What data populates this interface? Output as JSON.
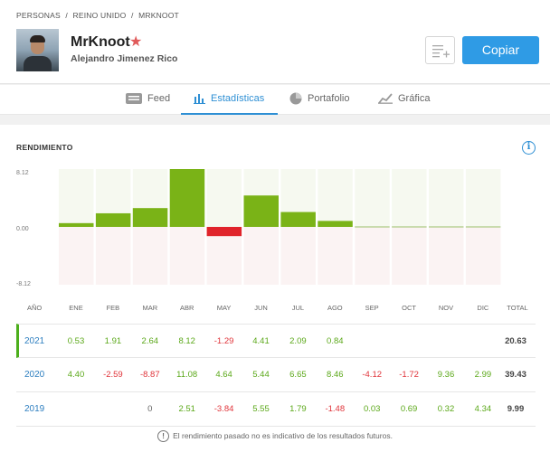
{
  "breadcrumb": [
    "PERSONAS",
    "/",
    "REINO UNIDO",
    "/",
    "MRKNOOT"
  ],
  "profile": {
    "username": "MrKnoot",
    "fullname": "Alejandro Jimenez Rico",
    "star": "★"
  },
  "buttons": {
    "copy": "Copiar"
  },
  "tabs": [
    {
      "label": "Feed",
      "icon": "feed-icon"
    },
    {
      "label": "Estadísticas",
      "icon": "stats-icon",
      "active": true
    },
    {
      "label": "Portafolio",
      "icon": "pie-icon"
    },
    {
      "label": "Gráfica",
      "icon": "chart-icon"
    }
  ],
  "stats": {
    "title": "RENDIMIENTO",
    "info": "i",
    "headers": {
      "year": "AÑO",
      "total": "TOTAL"
    },
    "months": [
      "ENE",
      "FEB",
      "MAR",
      "ABR",
      "MAY",
      "JUN",
      "JUL",
      "AGO",
      "SEP",
      "OCT",
      "NOV",
      "DIC"
    ],
    "rows": [
      {
        "year": "2021",
        "values": [
          "0.53",
          "1.91",
          "2.64",
          "8.12",
          "-1.29",
          "4.41",
          "2.09",
          "0.84",
          "",
          "",
          "",
          ""
        ],
        "total": "20.63"
      },
      {
        "year": "2020",
        "values": [
          "4.40",
          "-2.59",
          "-8.87",
          "11.08",
          "4.64",
          "5.44",
          "6.65",
          "8.46",
          "-4.12",
          "-1.72",
          "9.36",
          "2.99"
        ],
        "total": "39.43"
      },
      {
        "year": "2019",
        "values": [
          "",
          "",
          "0",
          "2.51",
          "-3.84",
          "5.55",
          "1.79",
          "-1.48",
          "0.03",
          "0.69",
          "0.32",
          "4.34"
        ],
        "total": "9.99"
      }
    ],
    "disclaimer_icon": "!",
    "disclaimer": "El rendimiento pasado no es indicativo de los resultados futuros."
  },
  "chart_data": {
    "type": "bar",
    "categories": [
      "ENE",
      "FEB",
      "MAR",
      "ABR",
      "MAY",
      "JUN",
      "JUL",
      "AGO",
      "SEP",
      "OCT",
      "NOV",
      "DIC"
    ],
    "values": [
      0.53,
      1.91,
      2.64,
      8.12,
      -1.29,
      4.41,
      2.09,
      0.84,
      null,
      null,
      null,
      null
    ],
    "ylim": [
      -8.12,
      8.12
    ],
    "yticks": [
      "8.12",
      "0.00",
      "-8.12"
    ],
    "colors": {
      "positive": "#7ab317",
      "negative": "#e0242b",
      "pos_bg": "#f6f9f0",
      "neg_bg": "#fbf3f3"
    }
  }
}
